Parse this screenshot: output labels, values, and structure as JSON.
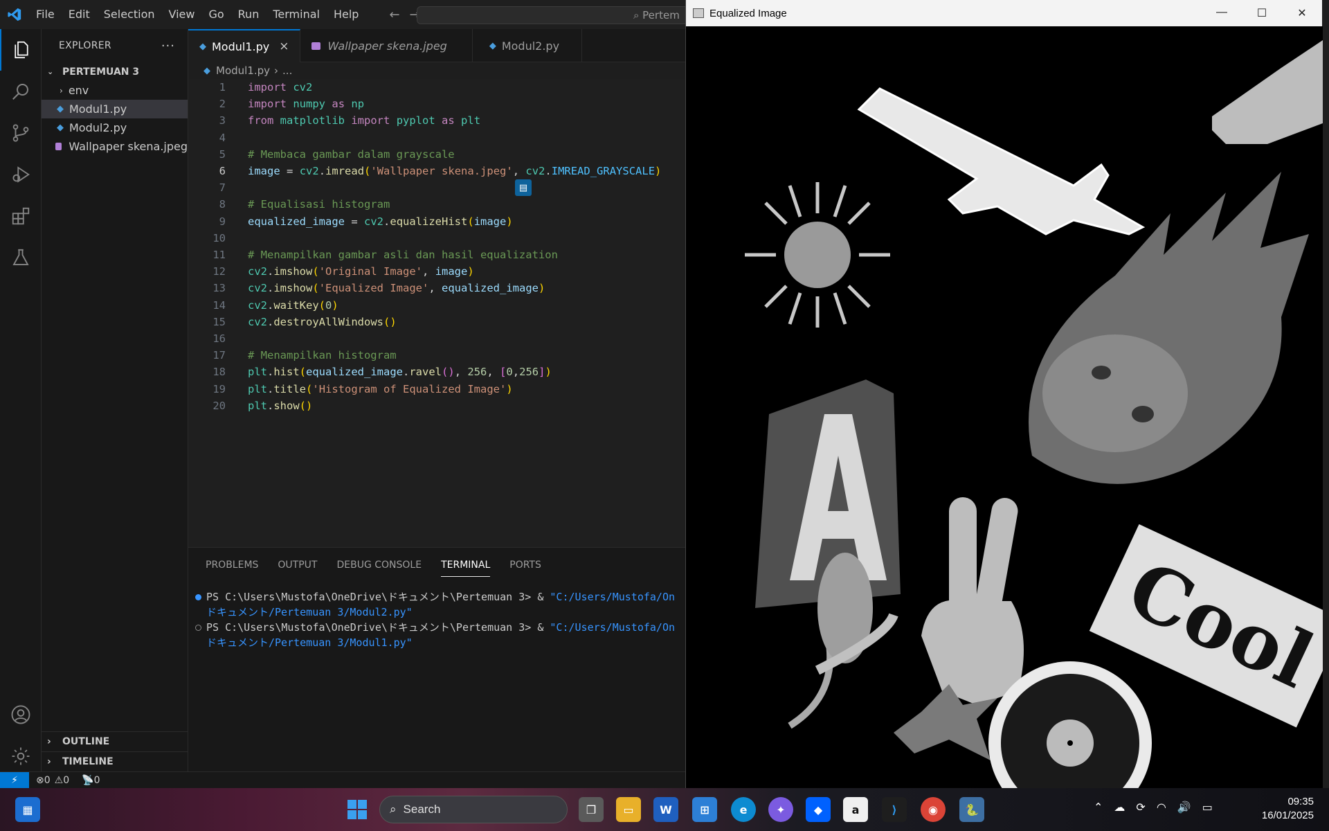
{
  "menu": [
    "File",
    "Edit",
    "Selection",
    "View",
    "Go",
    "Run",
    "Terminal",
    "Help"
  ],
  "command_center": "Pertem",
  "explorer": {
    "title": "EXPLORER",
    "folder": "PERTEMUAN 3",
    "items": [
      {
        "label": "env",
        "type": "folder"
      },
      {
        "label": "Modul1.py",
        "type": "py"
      },
      {
        "label": "Modul2.py",
        "type": "py"
      },
      {
        "label": "Wallpaper skena.jpeg",
        "type": "img"
      }
    ],
    "outline": "OUTLINE",
    "timeline": "TIMELINE"
  },
  "tabs": [
    {
      "label": "Modul1.py",
      "active": true
    },
    {
      "label": "Wallpaper skena.jpeg",
      "active": false
    },
    {
      "label": "Modul2.py",
      "active": false
    }
  ],
  "breadcrumb": {
    "file": "Modul1.py",
    "rest": "..."
  },
  "code_lines": [
    "import cv2",
    "import numpy as np",
    "from matplotlib import pyplot as plt",
    "",
    "# Membaca gambar dalam grayscale",
    "image = cv2.imread('Wallpaper skena.jpeg', cv2.IMREAD_GRAYSCALE)",
    "",
    "# Equalisasi histogram",
    "equalized_image = cv2.equalizeHist(image)",
    "",
    "# Menampilkan gambar asli dan hasil equalization",
    "cv2.imshow('Original Image', image)",
    "cv2.imshow('Equalized Image', equalized_image)",
    "cv2.waitKey(0)",
    "cv2.destroyAllWindows()",
    "",
    "# Menampilkan histogram",
    "plt.hist(equalized_image.ravel(), 256, [0,256])",
    "plt.title('Histogram of Equalized Image')",
    "plt.show()"
  ],
  "current_line": 6,
  "panel": {
    "tabs": [
      "PROBLEMS",
      "OUTPUT",
      "DEBUG CONSOLE",
      "TERMINAL",
      "PORTS"
    ],
    "active_tab": "TERMINAL",
    "terminal": [
      {
        "prompt": "PS C:\\Users\\Mustofa\\OneDrive\\ドキュメント\\Pertemuan 3> & ",
        "path": "\"C:/Users/Mustofa/On",
        "cont": "ドキュメント/Pertemuan 3/Modul2.py\"",
        "dot": "#3794ff"
      },
      {
        "prompt": "PS C:\\Users\\Mustofa\\OneDrive\\ドキュメント\\Pertemuan 3> & ",
        "path": "\"C:/Users/Mustofa/On",
        "cont": "ドキュメント/Pertemuan 3/Modul1.py\"",
        "dot": "#777"
      }
    ]
  },
  "status": {
    "errors": "0",
    "warnings": "0",
    "ports": "0"
  },
  "image_window": {
    "title": "Equalized Image"
  },
  "taskbar": {
    "search": "Search",
    "time": "09:35",
    "date": "16/01/2025"
  }
}
